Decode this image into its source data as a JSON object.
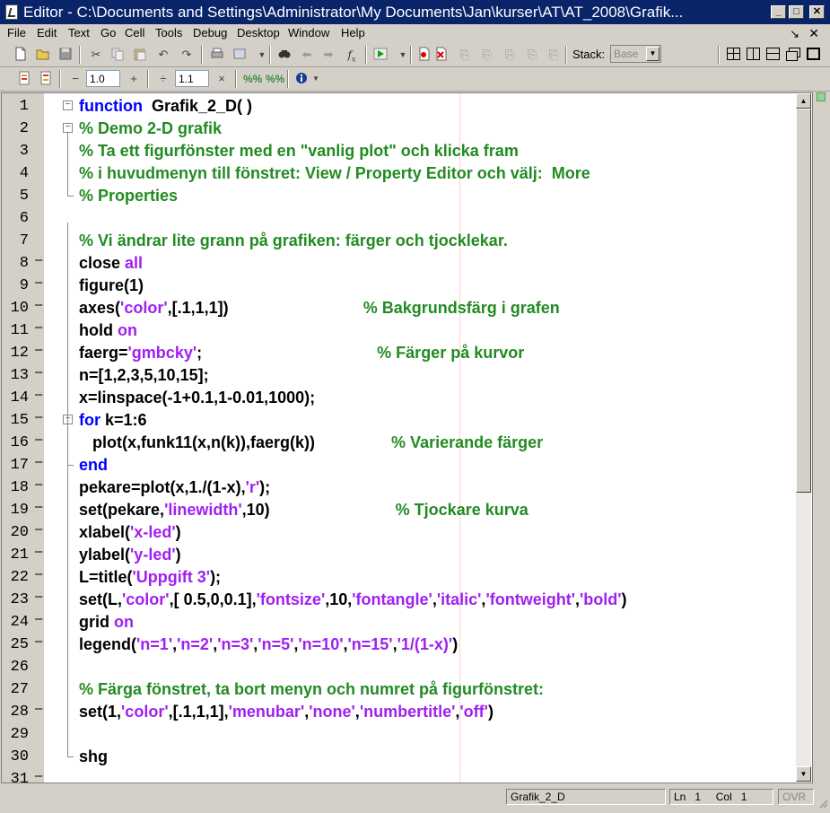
{
  "window": {
    "title": "Editor - C:\\Documents and Settings\\Administrator\\My Documents\\Jan\\kurser\\AT\\AT_2008\\Grafik...",
    "minimize": "_",
    "maximize": "□",
    "close": "✕"
  },
  "menu": {
    "items": [
      {
        "label": "File"
      },
      {
        "label": "Edit"
      },
      {
        "label": "Text"
      },
      {
        "label": "Go"
      },
      {
        "label": "Cell"
      },
      {
        "label": "Tools"
      },
      {
        "label": "Debug"
      },
      {
        "label": "Desktop"
      },
      {
        "label": "Window"
      },
      {
        "label": "Help"
      }
    ],
    "undock": "↘",
    "close": "✕"
  },
  "toolbar": {
    "stack_label": "Stack:",
    "stack_value": "Base",
    "icons": [
      "new-file-icon",
      "open-icon",
      "save-icon",
      "cut-icon",
      "copy-icon",
      "paste-icon",
      "undo-icon",
      "redo-icon",
      "print-icon",
      "find-file-icon",
      "find-icon",
      "back-icon",
      "forward-icon",
      "function-icon",
      "run-icon",
      "set-breakpoint-icon",
      "clear-breakpoints-icon",
      "step-icon",
      "step-in-icon",
      "step-out-icon",
      "continue-icon",
      "exit-debug-icon"
    ]
  },
  "cell_toolbar": {
    "minus": "−",
    "increment_value": "1.0",
    "plus": "+",
    "divide": "÷",
    "factor_value": "1.1",
    "times": "×"
  },
  "code_lines": [
    {
      "n": "1",
      "dash": false,
      "fold": "minus",
      "tokens": [
        {
          "t": "kw",
          "v": "function"
        },
        {
          "t": "plain",
          "v": "  Grafik_2_D( )"
        }
      ]
    },
    {
      "n": "2",
      "dash": false,
      "fold": "minus",
      "tokens": [
        {
          "t": "cm",
          "v": "% Demo 2-D grafik"
        }
      ]
    },
    {
      "n": "3",
      "dash": false,
      "fold": "",
      "tokens": [
        {
          "t": "cm",
          "v": "% Ta ett figurfönster med en \"vanlig plot\" och klicka fram"
        }
      ]
    },
    {
      "n": "4",
      "dash": false,
      "fold": "",
      "tokens": [
        {
          "t": "cm",
          "v": "% i huvudmenyn till fönstret: View / Property Editor och välj:  More"
        }
      ]
    },
    {
      "n": "5",
      "dash": false,
      "fold": "end",
      "tokens": [
        {
          "t": "cm",
          "v": "% Properties"
        }
      ]
    },
    {
      "n": "6",
      "dash": false,
      "fold": "",
      "tokens": []
    },
    {
      "n": "7",
      "dash": false,
      "fold": "",
      "tokens": [
        {
          "t": "cm",
          "v": "% Vi ändrar lite grann på grafiken: färger och tjocklekar."
        }
      ]
    },
    {
      "n": "8",
      "dash": true,
      "fold": "",
      "tokens": [
        {
          "t": "plain",
          "v": "close "
        },
        {
          "t": "str",
          "v": "all"
        }
      ]
    },
    {
      "n": "9",
      "dash": true,
      "fold": "",
      "tokens": [
        {
          "t": "plain",
          "v": "figure(1)"
        }
      ]
    },
    {
      "n": "10",
      "dash": true,
      "fold": "",
      "tokens": [
        {
          "t": "plain",
          "v": "axes("
        },
        {
          "t": "str",
          "v": "'color'"
        },
        {
          "t": "plain",
          "v": ",[.1,1,1])                              "
        },
        {
          "t": "cm",
          "v": "% Bakgrundsfärg i grafen"
        }
      ]
    },
    {
      "n": "11",
      "dash": true,
      "fold": "",
      "tokens": [
        {
          "t": "plain",
          "v": "hold "
        },
        {
          "t": "str",
          "v": "on"
        }
      ]
    },
    {
      "n": "12",
      "dash": true,
      "fold": "",
      "tokens": [
        {
          "t": "plain",
          "v": "faerg="
        },
        {
          "t": "str",
          "v": "'gmbcky'"
        },
        {
          "t": "plain",
          "v": ";                                       "
        },
        {
          "t": "cm",
          "v": "% Färger på kurvor"
        }
      ]
    },
    {
      "n": "13",
      "dash": true,
      "fold": "",
      "tokens": [
        {
          "t": "plain",
          "v": "n=[1,2,3,5,10,15];"
        }
      ]
    },
    {
      "n": "14",
      "dash": true,
      "fold": "",
      "tokens": [
        {
          "t": "plain",
          "v": "x=linspace(-1+0.1,1-0.01,1000);"
        }
      ]
    },
    {
      "n": "15",
      "dash": true,
      "fold": "minus",
      "tokens": [
        {
          "t": "kw",
          "v": "for"
        },
        {
          "t": "plain",
          "v": " k=1:6"
        }
      ]
    },
    {
      "n": "16",
      "dash": true,
      "fold": "",
      "tokens": [
        {
          "t": "plain",
          "v": "   plot(x,funk11(x,n(k)),faerg(k))                 "
        },
        {
          "t": "cm",
          "v": "% Varierande färger"
        }
      ]
    },
    {
      "n": "17",
      "dash": true,
      "fold": "end",
      "tokens": [
        {
          "t": "kw",
          "v": "end"
        }
      ]
    },
    {
      "n": "18",
      "dash": true,
      "fold": "",
      "tokens": [
        {
          "t": "plain",
          "v": "pekare=plot(x,1./(1-x),"
        },
        {
          "t": "str",
          "v": "'r'"
        },
        {
          "t": "plain",
          "v": ");"
        }
      ]
    },
    {
      "n": "19",
      "dash": true,
      "fold": "",
      "tokens": [
        {
          "t": "plain",
          "v": "set(pekare,"
        },
        {
          "t": "str",
          "v": "'linewidth'"
        },
        {
          "t": "plain",
          "v": ",10)                            "
        },
        {
          "t": "cm",
          "v": "% Tjockare kurva"
        }
      ]
    },
    {
      "n": "20",
      "dash": true,
      "fold": "",
      "tokens": [
        {
          "t": "plain",
          "v": "xlabel("
        },
        {
          "t": "str",
          "v": "'x-led'"
        },
        {
          "t": "plain",
          "v": ")"
        }
      ]
    },
    {
      "n": "21",
      "dash": true,
      "fold": "",
      "tokens": [
        {
          "t": "plain",
          "v": "ylabel("
        },
        {
          "t": "str",
          "v": "'y-led'"
        },
        {
          "t": "plain",
          "v": ")"
        }
      ]
    },
    {
      "n": "22",
      "dash": true,
      "fold": "",
      "tokens": [
        {
          "t": "plain",
          "v": "L=title("
        },
        {
          "t": "str",
          "v": "'Uppgift 3'"
        },
        {
          "t": "plain",
          "v": ");"
        }
      ]
    },
    {
      "n": "23",
      "dash": true,
      "fold": "",
      "tokens": [
        {
          "t": "plain",
          "v": "set(L,"
        },
        {
          "t": "str",
          "v": "'color'"
        },
        {
          "t": "plain",
          "v": ",[ 0.5,0,0.1],"
        },
        {
          "t": "str",
          "v": "'fontsize'"
        },
        {
          "t": "plain",
          "v": ",10,"
        },
        {
          "t": "str",
          "v": "'fontangle'"
        },
        {
          "t": "plain",
          "v": ","
        },
        {
          "t": "str",
          "v": "'italic'"
        },
        {
          "t": "plain",
          "v": ","
        },
        {
          "t": "str",
          "v": "'fontweight'"
        },
        {
          "t": "plain",
          "v": ","
        },
        {
          "t": "str",
          "v": "'bold'"
        },
        {
          "t": "plain",
          "v": ")"
        }
      ]
    },
    {
      "n": "24",
      "dash": true,
      "fold": "",
      "tokens": [
        {
          "t": "plain",
          "v": "grid "
        },
        {
          "t": "str",
          "v": "on"
        }
      ]
    },
    {
      "n": "25",
      "dash": true,
      "fold": "",
      "tokens": [
        {
          "t": "plain",
          "v": "legend("
        },
        {
          "t": "str",
          "v": "'n=1'"
        },
        {
          "t": "plain",
          "v": ","
        },
        {
          "t": "str",
          "v": "'n=2'"
        },
        {
          "t": "plain",
          "v": ","
        },
        {
          "t": "str",
          "v": "'n=3'"
        },
        {
          "t": "plain",
          "v": ","
        },
        {
          "t": "str",
          "v": "'n=5'"
        },
        {
          "t": "plain",
          "v": ","
        },
        {
          "t": "str",
          "v": "'n=10'"
        },
        {
          "t": "plain",
          "v": ","
        },
        {
          "t": "str",
          "v": "'n=15'"
        },
        {
          "t": "plain",
          "v": ","
        },
        {
          "t": "str",
          "v": "'1/(1-x)'"
        },
        {
          "t": "plain",
          "v": ")"
        }
      ]
    },
    {
      "n": "26",
      "dash": false,
      "fold": "",
      "tokens": []
    },
    {
      "n": "27",
      "dash": false,
      "fold": "",
      "tokens": [
        {
          "t": "cm",
          "v": "% Färga fönstret, ta bort menyn och numret på figurfönstret:"
        }
      ]
    },
    {
      "n": "28",
      "dash": true,
      "fold": "",
      "tokens": [
        {
          "t": "plain",
          "v": "set(1,"
        },
        {
          "t": "str",
          "v": "'color'"
        },
        {
          "t": "plain",
          "v": ",[.1,1,1],"
        },
        {
          "t": "str",
          "v": "'menubar'"
        },
        {
          "t": "plain",
          "v": ","
        },
        {
          "t": "str",
          "v": "'none'"
        },
        {
          "t": "plain",
          "v": ","
        },
        {
          "t": "str",
          "v": "'numbertitle'"
        },
        {
          "t": "plain",
          "v": ","
        },
        {
          "t": "str",
          "v": "'off'"
        },
        {
          "t": "plain",
          "v": ")"
        }
      ]
    },
    {
      "n": "29",
      "dash": false,
      "fold": "",
      "tokens": []
    },
    {
      "n": "30",
      "dash": false,
      "fold": "end",
      "tokens": [
        {
          "t": "plain",
          "v": "shg"
        }
      ]
    },
    {
      "n": "31",
      "dash": true,
      "fold": "",
      "tokens": []
    }
  ],
  "status": {
    "filename": "Grafik_2_D",
    "ln_label": "Ln",
    "ln_value": "1",
    "col_label": "Col",
    "col_value": "1",
    "ovr": "OVR"
  },
  "colors": {
    "keyword": "#0000ff",
    "string": "#a020f0",
    "comment": "#228b22",
    "titlebar": "#0a246a"
  }
}
